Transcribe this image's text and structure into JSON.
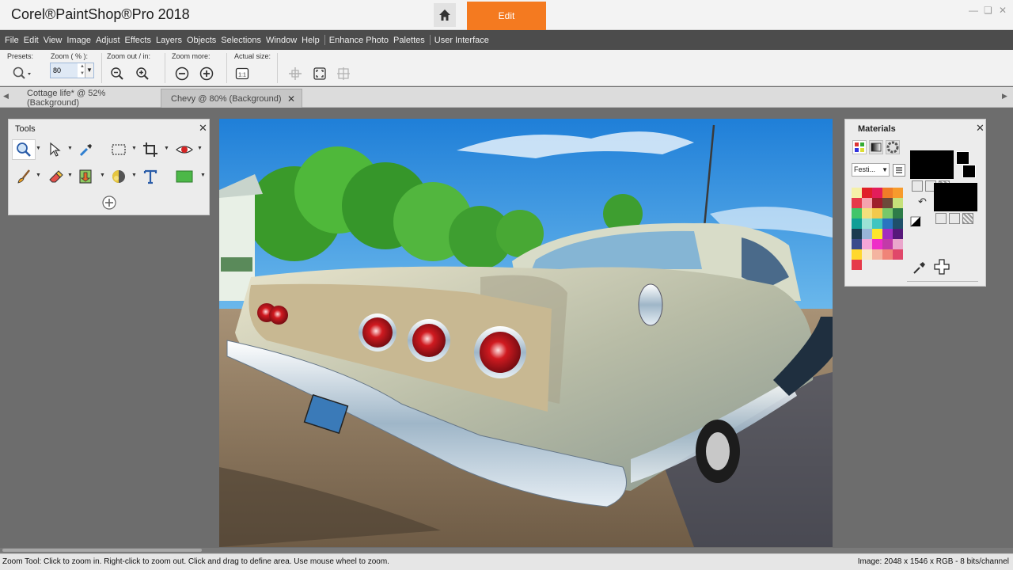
{
  "titlebar": {
    "app_title": "Corel®PaintShop®Pro 2018",
    "workspace_tab": "Edit"
  },
  "menu": {
    "items": [
      "File",
      "Edit",
      "View",
      "Image",
      "Adjust",
      "Effects",
      "Layers",
      "Objects",
      "Selections",
      "Window",
      "Help",
      "Enhance Photo",
      "Palettes",
      "User Interface"
    ]
  },
  "options": {
    "presets_label": "Presets:",
    "zoom_label": "Zoom ( % ):",
    "zoom_value": "80",
    "zoom_out_in_label": "Zoom out / in:",
    "zoom_more_label": "Zoom more:",
    "actual_size_label": "Actual size:"
  },
  "documents": {
    "tabs": [
      {
        "label": "Cottage life* @  52% (Background)",
        "active": false
      },
      {
        "label": "Chevy @  80% (Background)",
        "active": true
      }
    ]
  },
  "tools_palette": {
    "title": "Tools"
  },
  "materials_palette": {
    "title": "Materials",
    "swatch_set": "Festi...",
    "foreground_color": "#000000",
    "background_color": "#000000",
    "swatches": [
      "#f5f0a8",
      "#e02028",
      "#e31d5a",
      "#f07d28",
      "#f79b2c",
      "#e63a4a",
      "#f5a3ae",
      "#9f1f2a",
      "#6c4a3a",
      "#c6e17a",
      "#42c56a",
      "#f4e07c",
      "#f2c94c",
      "#77c86a",
      "#2d7c48",
      "#109e96",
      "#9be2d5",
      "#3fc5c0",
      "#2a74c0",
      "#1f4f6a",
      "#1c3b50",
      "#98b4d8",
      "#fde62a",
      "#a22ec0",
      "#57197a",
      "#3a4a8c",
      "#f4a6d8",
      "#ee2ec8",
      "#c23aa8",
      "#eaa6cc",
      "#ffd82e",
      "#f9e8c8",
      "#f4b4a0",
      "#f08478",
      "#e0486a",
      "#e63a4a"
    ]
  },
  "status": {
    "hint": "Zoom Tool: Click to zoom in. Right-click to zoom out. Click and drag to define area. Use mouse wheel to zoom.",
    "image_info": "Image:  2048 x 1546 x RGB - 8 bits/channel"
  }
}
